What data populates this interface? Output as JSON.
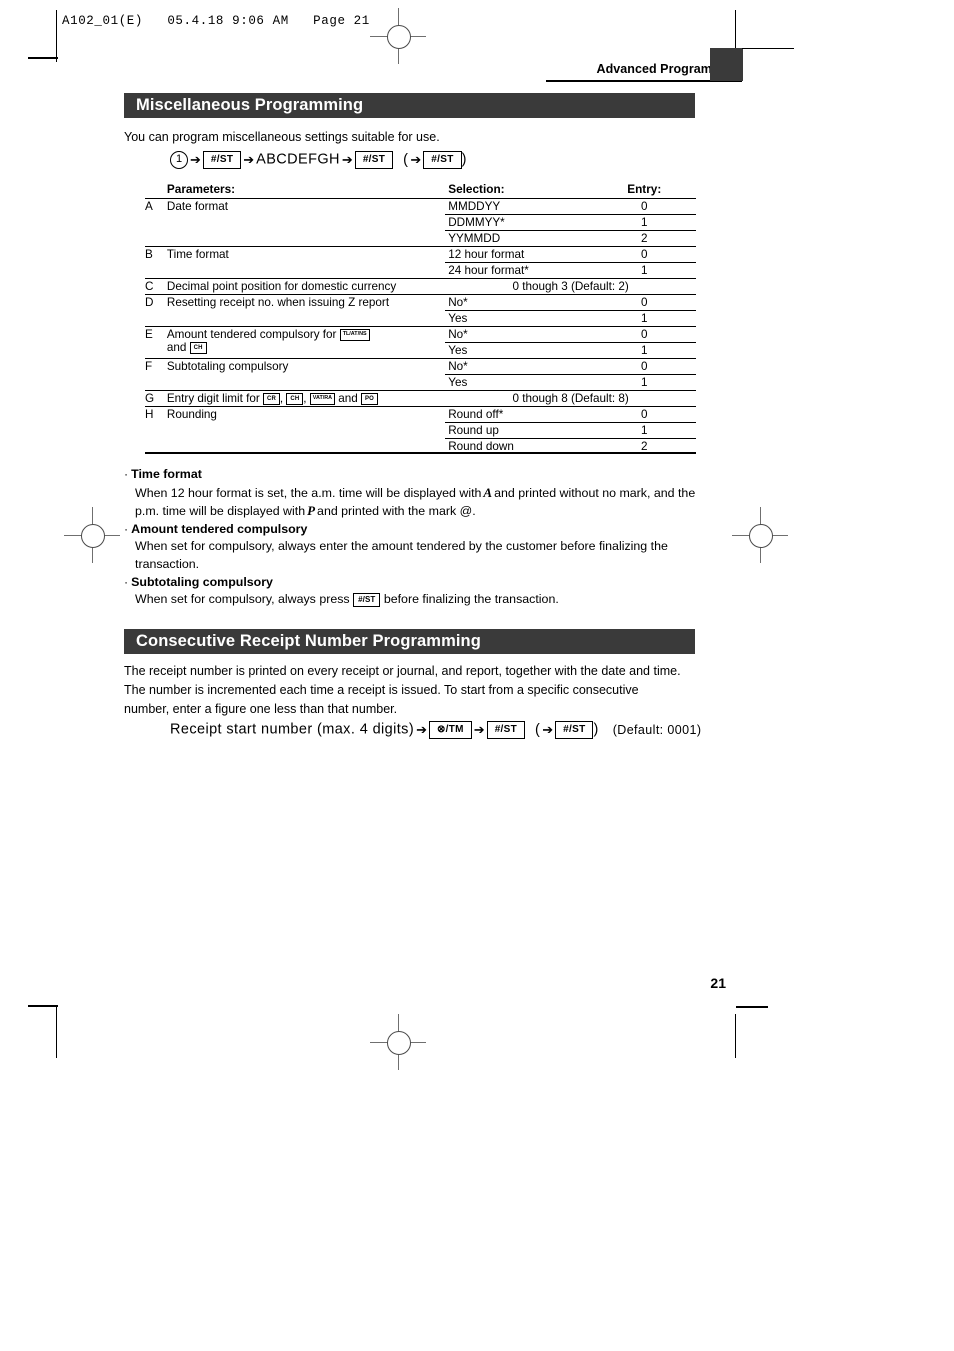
{
  "slug": "A102_01(E)   05.4.18 9:06 AM   Page 21",
  "running_head": "Advanced Programming",
  "page_number": "21",
  "sections": [
    {
      "id": "misc",
      "title": "Miscellaneous Programming",
      "intro": "You can program miscellaneous settings suitable for use.",
      "sequence": {
        "step1": "1",
        "key1": "#/ST",
        "letters": "ABCDEFGH",
        "key2": "#/ST",
        "open_paren": "(",
        "key3": "#/ST",
        "close_paren": ")",
        "arrow": "➔"
      }
    },
    {
      "id": "consec",
      "title": "Consecutive Receipt Number Programming",
      "paragraph": "The receipt number is printed on every receipt or journal, and report, together with the date and time.  The number is incremented each time a receipt is issued. To start from a specific consecutive number, enter a figure one less than that number.",
      "sequence": {
        "label": "Receipt start number (max. 4 digits)",
        "key1": "⊗/TM",
        "key2": "#/ST",
        "open_paren": "(",
        "key3": "#/ST",
        "close_paren": ")",
        "default": "(Default: 0001)",
        "arrow": "➔"
      }
    }
  ],
  "table": {
    "headers": {
      "parameters": "Parameters:",
      "selection": "Selection:",
      "entry": "Entry:"
    },
    "rows": [
      {
        "letter": "A",
        "desc": "Date format",
        "options": [
          {
            "selection": "MMDDYY",
            "entry": "0"
          },
          {
            "selection": "DDMMYY*",
            "entry": "1"
          },
          {
            "selection": "YYMMDD",
            "entry": "2"
          }
        ]
      },
      {
        "letter": "B",
        "desc": "Time format",
        "options": [
          {
            "selection": "12 hour format",
            "entry": "0"
          },
          {
            "selection": "24 hour format*",
            "entry": "1"
          }
        ]
      },
      {
        "letter": "C",
        "desc": "Decimal point position for domestic currency",
        "span": "0 though 3 (Default: 2)"
      },
      {
        "letter": "D",
        "desc": "Resetting receipt no. when issuing Z report",
        "options": [
          {
            "selection": "No*",
            "entry": "0"
          },
          {
            "selection": "Yes",
            "entry": "1"
          }
        ]
      },
      {
        "letter": "E",
        "desc_pre": "Amount tendered compulsory for",
        "desc_keys": [
          "TL/AT/NS",
          "CH"
        ],
        "desc_mid": "and",
        "options": [
          {
            "selection": "No*",
            "entry": "0"
          },
          {
            "selection": "Yes",
            "entry": "1"
          }
        ]
      },
      {
        "letter": "F",
        "desc": "Subtotaling compulsory",
        "options": [
          {
            "selection": "No*",
            "entry": "0"
          },
          {
            "selection": "Yes",
            "entry": "1"
          }
        ]
      },
      {
        "letter": "G",
        "desc_pre": "Entry digit limit for",
        "desc_keys": [
          "CR",
          "CH",
          "VAT/RA",
          "PO"
        ],
        "desc_mid": "and",
        "span": "0 though 8 (Default: 8)"
      },
      {
        "letter": "H",
        "desc": "Rounding",
        "options": [
          {
            "selection": "Round off*",
            "entry": "0"
          },
          {
            "selection": "Round up",
            "entry": "1"
          },
          {
            "selection": "Round down",
            "entry": "2"
          }
        ]
      }
    ]
  },
  "notes": [
    {
      "heading": "Time format",
      "text_1": "When 12 hour format is set, the a.m. time will be displayed with",
      "seg_1": "A",
      "text_2": "and printed without no mark, and the p.m. time will be displayed with",
      "seg_2": "P",
      "text_3": "and printed with the mark @."
    },
    {
      "heading": "Amount tendered compulsory",
      "text_1": "When set for compulsory, always enter the amount tendered by the customer before finalizing the transaction."
    },
    {
      "heading": "Subtotaling compulsory",
      "text_1": "When set for compulsory, always press",
      "key": "#/ST",
      "text_2": "before finalizing the transaction."
    }
  ],
  "colors": {
    "bar": "#3a3a3a",
    "text": "#000000",
    "mark": "#6f6f6f"
  }
}
